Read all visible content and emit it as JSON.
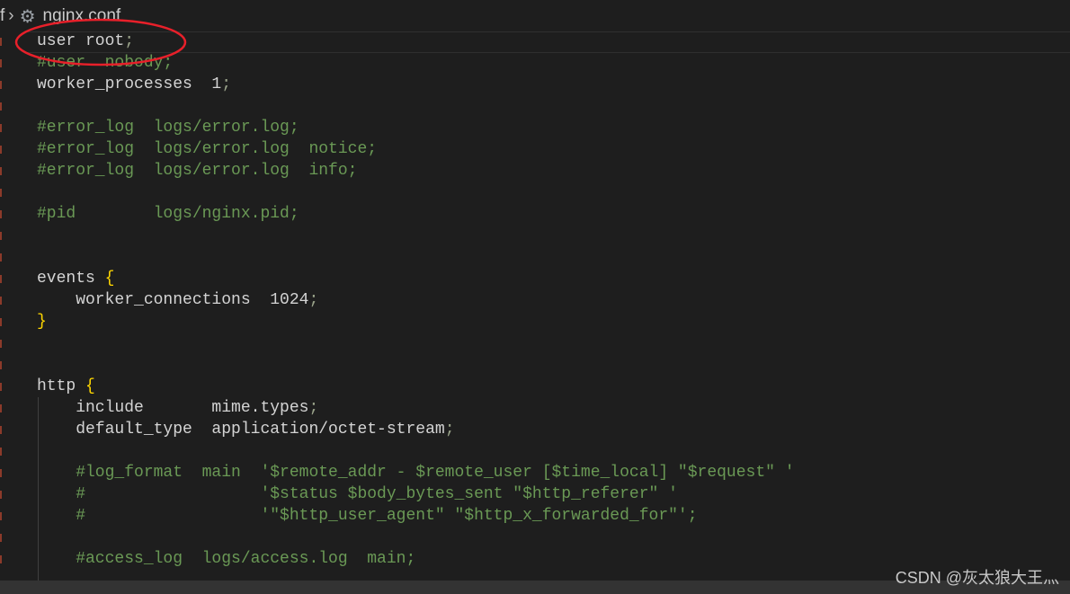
{
  "breadcrumb": {
    "parent": "f",
    "separator": "›",
    "file_icon": "gear-icon",
    "file": "nginx.conf"
  },
  "colors": {
    "background": "#1e1e1e",
    "text": "#d4d4d4",
    "comment": "#6a9955",
    "brace": "#ffd700",
    "annotation": "#e8202a"
  },
  "lines": [
    [
      {
        "t": "user root",
        "c": "plain"
      },
      {
        "t": ";",
        "c": "punct"
      }
    ],
    [
      {
        "t": "#user  nobody;",
        "c": "comment"
      }
    ],
    [
      {
        "t": "worker_processes  1",
        "c": "plain"
      },
      {
        "t": ";",
        "c": "punct"
      }
    ],
    [],
    [
      {
        "t": "#error_log  logs/error.log;",
        "c": "comment"
      }
    ],
    [
      {
        "t": "#error_log  logs/error.log  notice;",
        "c": "comment"
      }
    ],
    [
      {
        "t": "#error_log  logs/error.log  info;",
        "c": "comment"
      }
    ],
    [],
    [
      {
        "t": "#pid        logs/nginx.pid;",
        "c": "comment"
      }
    ],
    [],
    [],
    [
      {
        "t": "events ",
        "c": "plain"
      },
      {
        "t": "{",
        "c": "brace"
      }
    ],
    [
      {
        "t": "    worker_connections  1024",
        "c": "plain"
      },
      {
        "t": ";",
        "c": "punct"
      }
    ],
    [
      {
        "t": "}",
        "c": "brace"
      }
    ],
    [],
    [],
    [
      {
        "t": "http ",
        "c": "plain"
      },
      {
        "t": "{",
        "c": "brace"
      }
    ],
    [
      {
        "t": "    include       mime.types",
        "c": "plain"
      },
      {
        "t": ";",
        "c": "punct"
      }
    ],
    [
      {
        "t": "    default_type  application/octet-stream",
        "c": "plain"
      },
      {
        "t": ";",
        "c": "punct"
      }
    ],
    [],
    [
      {
        "t": "    #log_format  main  '$remote_addr - $remote_user [$time_local] \"$request\" '",
        "c": "comment"
      }
    ],
    [
      {
        "t": "    #                  '$status $body_bytes_sent \"$http_referer\" '",
        "c": "comment"
      }
    ],
    [
      {
        "t": "    #                  '\"$http_user_agent\" \"$http_x_forwarded_for\"';",
        "c": "comment"
      }
    ],
    [],
    [
      {
        "t": "    #access_log  logs/access.log  main;",
        "c": "comment"
      }
    ]
  ],
  "watermark": "CSDN @灰太狼大王灬"
}
